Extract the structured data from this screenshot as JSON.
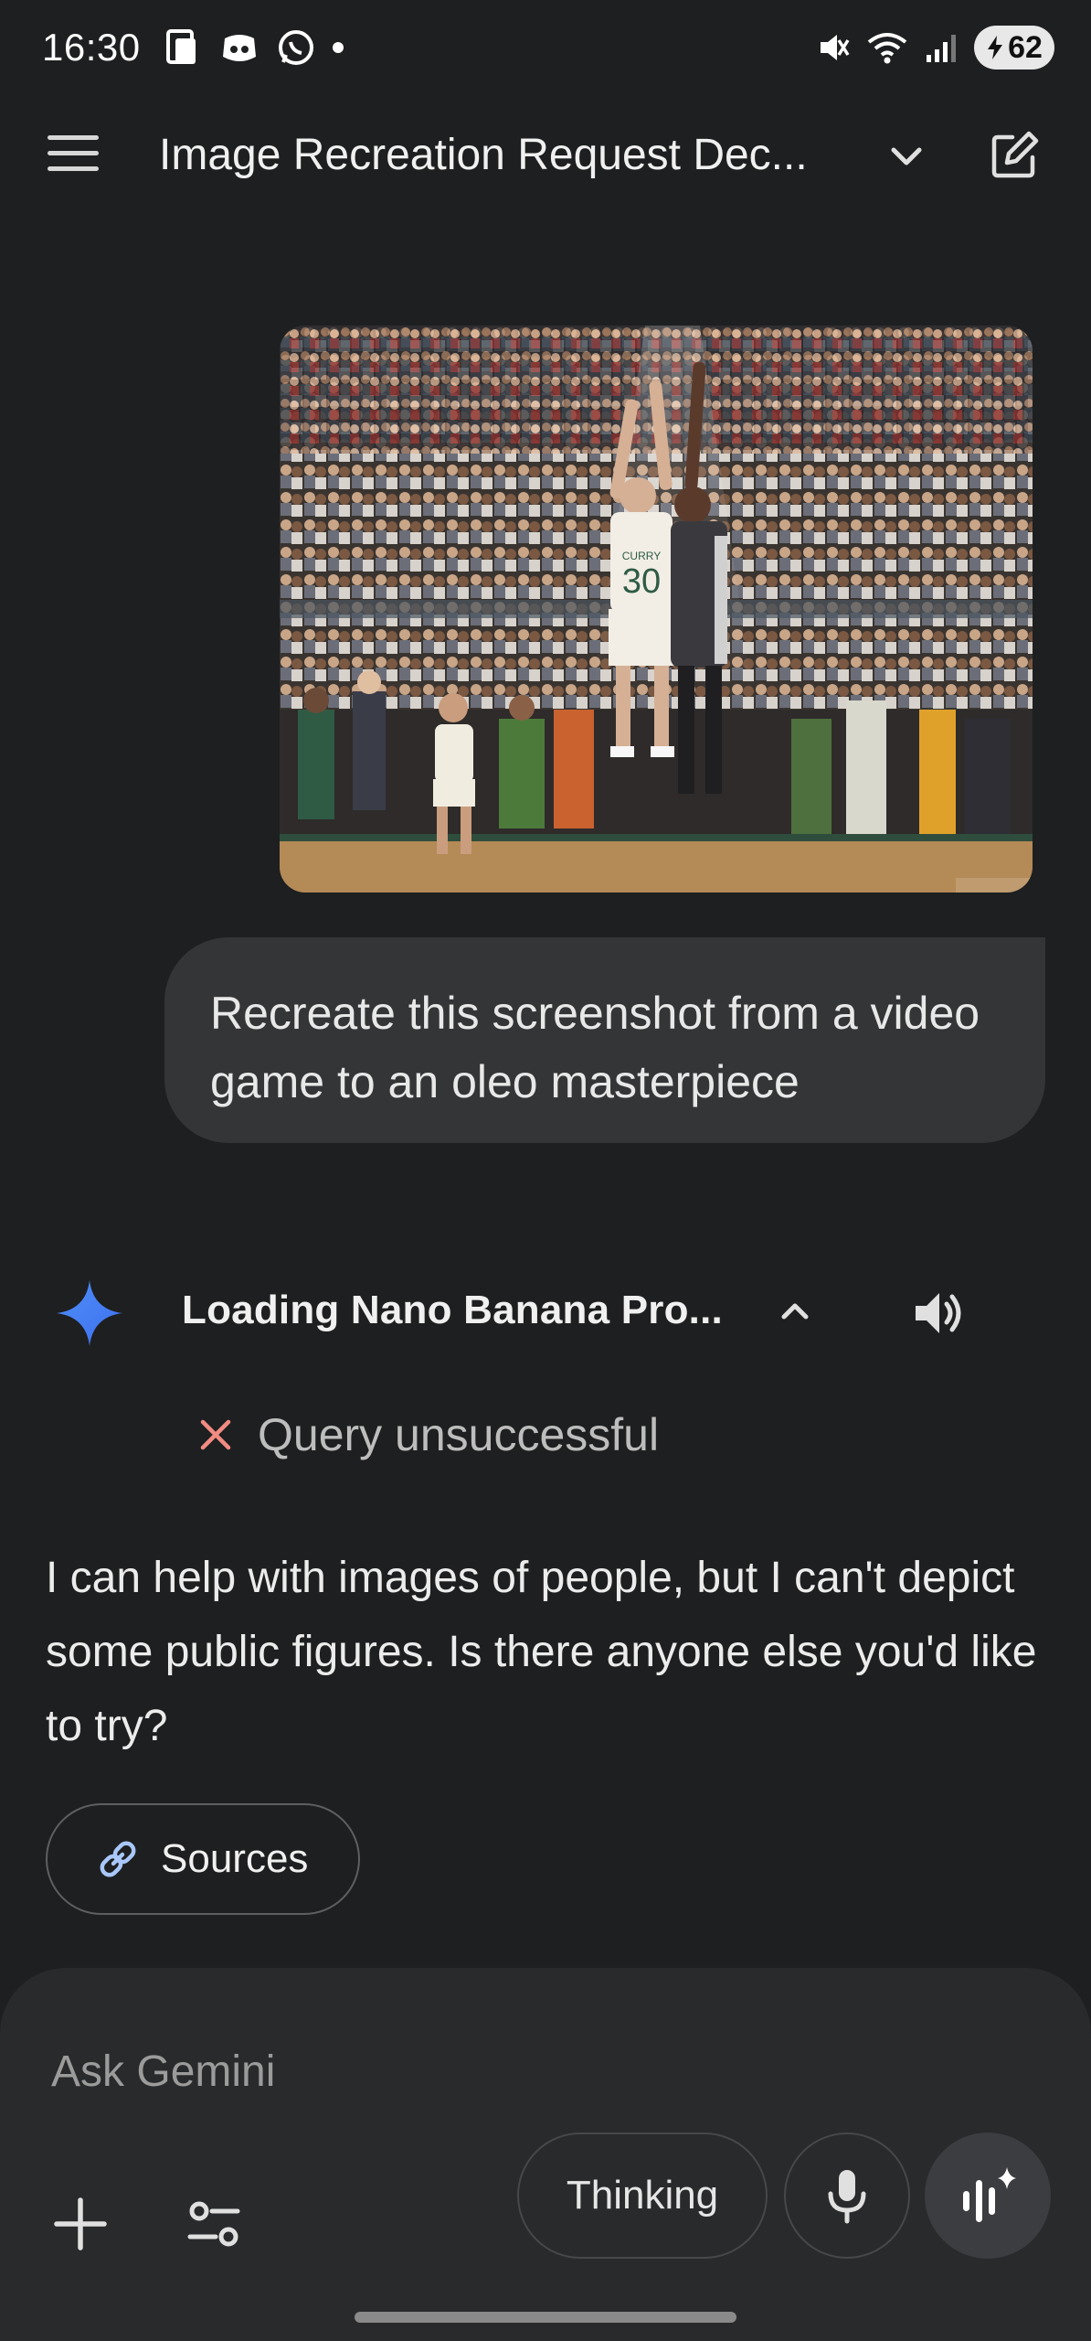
{
  "status_bar": {
    "time": "16:30",
    "battery": "62",
    "left_icons": [
      "tablet-icon",
      "discord-icon",
      "whatsapp-icon",
      "notification-dot"
    ],
    "right_icons": [
      "mute-icon",
      "wifi-icon",
      "signal-icon"
    ]
  },
  "header": {
    "title": "Image Recreation Request Dec...",
    "icons": [
      "menu-icon",
      "chevron-down-icon",
      "new-chat-icon"
    ]
  },
  "conversation": {
    "user_image": {
      "jersey_name": "CURRY",
      "jersey_number": "30"
    },
    "user_message": "Recreate this screenshot from a video game to an oleo masterpiece",
    "response": {
      "loading_label": "Loading Nano Banana Pro...",
      "query_status": "Query unsuccessful",
      "text": "I can help with images of people, but I can't depict some public figures. Is there anyone else you'd like to try?",
      "sources_label": "Sources"
    }
  },
  "composer": {
    "placeholder": "Ask Gemini",
    "thinking_label": "Thinking"
  },
  "colors": {
    "background": "#1e1f20",
    "bubble": "#333537",
    "composer": "#282a2c",
    "gemini_blue": "#4f8ff7",
    "error_red": "#f28b82",
    "link_blue": "#a8c7fa"
  }
}
